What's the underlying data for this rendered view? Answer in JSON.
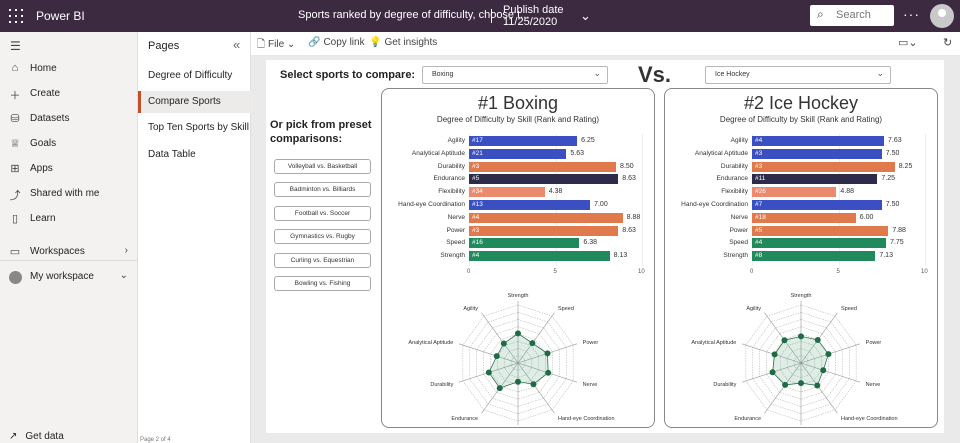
{
  "topbar": {
    "app_name": "Power BI",
    "report_title": "Sports ranked by degree of difficulty, choose t...",
    "publish_label": "Publish date",
    "publish_date": "11/25/2020",
    "search_placeholder": "Search",
    "more": "···"
  },
  "nav": {
    "items": [
      {
        "label": "Home",
        "icon": "home-icon"
      },
      {
        "label": "Create",
        "icon": "plus-icon"
      },
      {
        "label": "Datasets",
        "icon": "dataset-icon"
      },
      {
        "label": "Goals",
        "icon": "trophy-icon"
      },
      {
        "label": "Apps",
        "icon": "apps-icon"
      },
      {
        "label": "Shared with me",
        "icon": "share-icon"
      },
      {
        "label": "Learn",
        "icon": "book-icon"
      },
      {
        "label": "Workspaces",
        "icon": "workspaces-icon"
      },
      {
        "label": "My workspace",
        "icon": "avatar-icon"
      }
    ],
    "get_data": "Get data"
  },
  "pages": {
    "header": "Pages",
    "items": [
      "Degree of Difficulty",
      "Compare Sports",
      "Top Ten Sports by Skill ...",
      "Data Table"
    ],
    "active_index": 1,
    "page_indicator": "Page 2 of 4"
  },
  "toolbar": {
    "file": "File",
    "copy_link": "Copy link",
    "get_insights": "Get insights"
  },
  "report": {
    "select_label": "Select sports to compare:",
    "sport1": "Boxing",
    "sport2": "Ice Hockey",
    "vs": "Vs.",
    "preset_label": "Or pick from preset comparisons:",
    "presets": [
      "Volleyball vs. Basketball",
      "Badminton vs. Billiards",
      "Football vs. Soccer",
      "Gymnastics vs. Rugby",
      "Curling vs. Equestrian",
      "Bowling vs. Fishing"
    ]
  },
  "colors": {
    "blue": "#3a4fc2",
    "orange": "#e07a4c",
    "navy": "#2d2a4a",
    "salmon": "#ec8a6e",
    "green": "#218a5c",
    "topbar": "#3b2a40"
  },
  "chart_data": [
    {
      "type": "bar",
      "title": "#1 Boxing",
      "subtitle": "Degree of Difficulty by Skill (Rank and Rating)",
      "categories": [
        "Agility",
        "Analytical Aptitude",
        "Durability",
        "Endurance",
        "Flexibility",
        "Hand-eye Coordination",
        "Nerve",
        "Power",
        "Speed",
        "Strength"
      ],
      "values": [
        6.25,
        5.63,
        8.5,
        8.63,
        4.38,
        7.0,
        8.88,
        8.63,
        6.38,
        8.13
      ],
      "ranks": [
        "#17",
        "#21",
        "#3",
        "#5",
        "#34",
        "#13",
        "#4",
        "#3",
        "#16",
        "#4"
      ],
      "value_labels": [
        "6.25",
        "5.63",
        "8.50",
        "8.63",
        "4.38",
        "7.00",
        "8.88",
        "8.63",
        "6.38",
        "8.13"
      ],
      "bar_colors": [
        "blue",
        "blue",
        "orange",
        "navy",
        "salmon",
        "blue",
        "orange",
        "orange",
        "green",
        "green"
      ],
      "xlim": [
        0,
        10
      ],
      "xticks": [
        "0",
        "5",
        "10"
      ]
    },
    {
      "type": "bar",
      "title": "#2 Ice Hockey",
      "subtitle": "Degree of Difficulty by Skill (Rank and Rating)",
      "categories": [
        "Agility",
        "Analytical Aptitude",
        "Durability",
        "Endurance",
        "Flexibility",
        "Hand-eye Coordination",
        "Nerve",
        "Power",
        "Speed",
        "Strength"
      ],
      "values": [
        7.63,
        7.5,
        8.25,
        7.25,
        4.88,
        7.5,
        6.0,
        7.88,
        7.75,
        7.13
      ],
      "ranks": [
        "#4",
        "#3",
        "#3",
        "#11",
        "#26",
        "#7",
        "#18",
        "#5",
        "#4",
        "#8"
      ],
      "value_labels": [
        "7.63",
        "7.50",
        "8.25",
        "7.25",
        "4.88",
        "7.50",
        "6.00",
        "7.88",
        "7.75",
        "7.13"
      ],
      "bar_colors": [
        "blue",
        "blue",
        "orange",
        "navy",
        "salmon",
        "blue",
        "orange",
        "orange",
        "green",
        "green"
      ],
      "xlim": [
        0,
        10
      ],
      "xticks": [
        "0",
        "5",
        "10"
      ]
    }
  ],
  "radar": {
    "axes": [
      "Strength",
      "Speed",
      "Power",
      "Nerve",
      "Hand-eye Coordination",
      "Flexibility",
      "Endurance",
      "Durability",
      "Analytical Aptitude",
      "Agility"
    ]
  }
}
